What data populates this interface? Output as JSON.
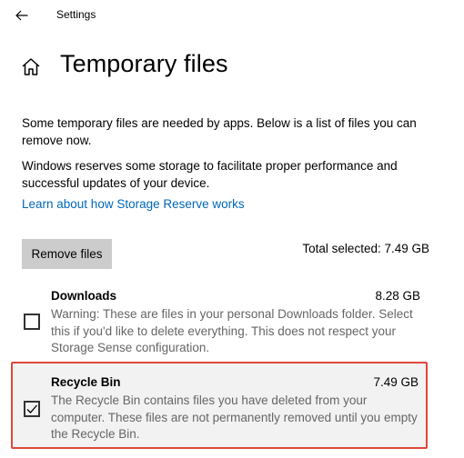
{
  "window": {
    "app_title": "Settings"
  },
  "header": {
    "page_title": "Temporary files"
  },
  "intro": {
    "paragraph_1": "Some temporary files are needed by apps. Below is a list of files you can remove now.",
    "paragraph_2": "Windows reserves some storage to facilitate proper performance and successful updates of your device.",
    "learn_link": "Learn about how Storage Reserve works"
  },
  "actions": {
    "remove_label": "Remove files",
    "total_selected": "Total selected: 7.49 GB"
  },
  "items": [
    {
      "name": "Downloads",
      "size": "8.28 GB",
      "description": "Warning: These are files in your personal Downloads folder. Select this if you'd like to delete everything. This does not respect your Storage Sense configuration.",
      "checked": false
    },
    {
      "name": "Recycle Bin",
      "size": "7.49 GB",
      "description": "The Recycle Bin contains files you have deleted from your computer. These files are not permanently removed until you empty the Recycle Bin.",
      "checked": true
    }
  ],
  "colors": {
    "link": "#0067b8",
    "highlight_border": "#e0473a",
    "button_bg": "#cccccc",
    "description_text": "#666666"
  },
  "icons": {
    "back": "back-arrow-icon",
    "home": "home-icon",
    "check": "checkmark-icon"
  }
}
